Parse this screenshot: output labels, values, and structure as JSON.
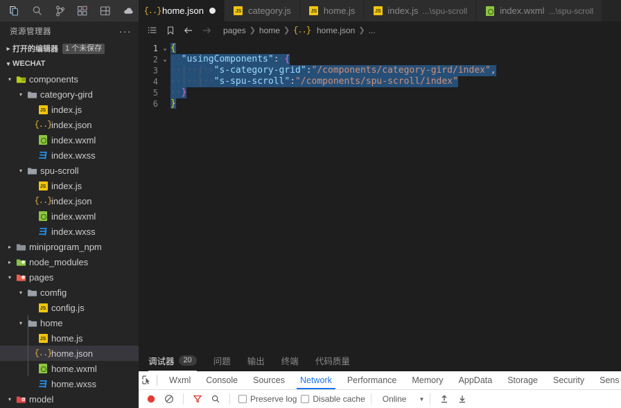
{
  "activity_bar": {
    "icons": [
      {
        "name": "explorer-icon",
        "label": "Explorer"
      },
      {
        "name": "search-icon",
        "label": "Search"
      },
      {
        "name": "source-control-icon",
        "label": "Source Control"
      },
      {
        "name": "extensions-icon",
        "label": "Extensions"
      },
      {
        "name": "layout-icon",
        "label": "Layout"
      },
      {
        "name": "debug-cloud-icon",
        "label": "Cloud"
      }
    ]
  },
  "explorer": {
    "title": "资源管理器",
    "more_label": "···",
    "open_editors": {
      "label": "打开的编辑器",
      "badge": "1 个未保存",
      "twisty": "▸"
    },
    "workspace": {
      "label": "WECHAT",
      "twisty": "▾"
    },
    "tree": [
      {
        "label": "components",
        "depth": 1,
        "type": "folder-components",
        "twisty": "▾"
      },
      {
        "label": "category-gird",
        "depth": 2,
        "type": "folder",
        "twisty": "▾"
      },
      {
        "label": "index.js",
        "depth": 3,
        "type": "js",
        "twisty": ""
      },
      {
        "label": "index.json",
        "depth": 3,
        "type": "json",
        "twisty": ""
      },
      {
        "label": "index.wxml",
        "depth": 3,
        "type": "wxml",
        "twisty": ""
      },
      {
        "label": "index.wxss",
        "depth": 3,
        "type": "wxss",
        "twisty": ""
      },
      {
        "label": "spu-scroll",
        "depth": 2,
        "type": "folder",
        "twisty": "▾"
      },
      {
        "label": "index.js",
        "depth": 3,
        "type": "js",
        "twisty": ""
      },
      {
        "label": "index.json",
        "depth": 3,
        "type": "json",
        "twisty": ""
      },
      {
        "label": "index.wxml",
        "depth": 3,
        "type": "wxml",
        "twisty": ""
      },
      {
        "label": "index.wxss",
        "depth": 3,
        "type": "wxss",
        "twisty": ""
      },
      {
        "label": "miniprogram_npm",
        "depth": 1,
        "type": "folder-dark",
        "twisty": "▸"
      },
      {
        "label": "node_modules",
        "depth": 1,
        "type": "folder-node",
        "twisty": "▸"
      },
      {
        "label": "pages",
        "depth": 1,
        "type": "folder-pages",
        "twisty": "▾"
      },
      {
        "label": "comfig",
        "depth": 2,
        "type": "folder",
        "twisty": "▾"
      },
      {
        "label": "config.js",
        "depth": 3,
        "type": "js",
        "twisty": ""
      },
      {
        "label": "home",
        "depth": 2,
        "type": "folder",
        "twisty": "▾"
      },
      {
        "label": "home.js",
        "depth": 3,
        "type": "js",
        "twisty": ""
      },
      {
        "label": "home.json",
        "depth": 3,
        "type": "json",
        "twisty": "",
        "selected": true
      },
      {
        "label": "home.wxml",
        "depth": 3,
        "type": "wxml",
        "twisty": ""
      },
      {
        "label": "home.wxss",
        "depth": 3,
        "type": "wxss",
        "twisty": ""
      },
      {
        "label": "model",
        "depth": 1,
        "type": "folder-model",
        "twisty": "▾"
      }
    ]
  },
  "tabs": [
    {
      "label": "home.json",
      "sub": "",
      "type": "json",
      "active": true,
      "dirty": true
    },
    {
      "label": "category.js",
      "sub": "",
      "type": "js",
      "active": false,
      "dirty": false
    },
    {
      "label": "home.js",
      "sub": "",
      "type": "js",
      "active": false,
      "dirty": false
    },
    {
      "label": "index.js",
      "sub": "...\\spu-scroll",
      "type": "js",
      "active": false,
      "dirty": false
    },
    {
      "label": "index.wxml",
      "sub": "...\\spu-scroll",
      "type": "wxml",
      "active": false,
      "dirty": false
    }
  ],
  "breadcrumbs": {
    "buttons": [
      "list-icon",
      "bookmark-icon",
      "arrow-left-icon",
      "arrow-right-icon"
    ],
    "path": [
      "pages",
      "home",
      "home.json",
      "..."
    ]
  },
  "editor": {
    "lines": [
      {
        "num": "1",
        "fold": "⌄",
        "indent": 0
      },
      {
        "num": "2",
        "fold": "⌄",
        "indent": 1
      },
      {
        "num": "3",
        "fold": "",
        "indent": 2
      },
      {
        "num": "4",
        "fold": "",
        "indent": 2
      },
      {
        "num": "5",
        "fold": "",
        "indent": 1
      },
      {
        "num": "6",
        "fold": "",
        "indent": 0
      }
    ],
    "line1_open": "{",
    "line2_key": "\"usingComponents\"",
    "line2_colon": ":",
    "line2_brace": "{",
    "line3_key": "\"s-category-grid\"",
    "line3_colon": ":",
    "line3_val": "\"/components/category-gird/index\"",
    "line3_comma": ",",
    "line4_key": "\"s-spu-scroll\"",
    "line4_colon": ":",
    "line4_val": "\"/components/spu-scroll/index\"",
    "line5_close": "}",
    "line6_close": "}"
  },
  "panel": {
    "tabs": [
      {
        "label": "调试器",
        "badge": "20",
        "active": true
      },
      {
        "label": "问题",
        "badge": "",
        "active": false
      },
      {
        "label": "输出",
        "badge": "",
        "active": false
      },
      {
        "label": "终端",
        "badge": "",
        "active": false
      },
      {
        "label": "代码质量",
        "badge": "",
        "active": false
      }
    ]
  },
  "devtools": {
    "inspect_icon": "inspect-element-icon",
    "tabs": [
      {
        "label": "Wxml",
        "active": false
      },
      {
        "label": "Console",
        "active": false
      },
      {
        "label": "Sources",
        "active": false
      },
      {
        "label": "Network",
        "active": true
      },
      {
        "label": "Performance",
        "active": false
      },
      {
        "label": "Memory",
        "active": false
      },
      {
        "label": "AppData",
        "active": false
      },
      {
        "label": "Storage",
        "active": false
      },
      {
        "label": "Security",
        "active": false
      },
      {
        "label": "Sens",
        "active": false
      }
    ],
    "toolbar": {
      "record_label": "record-button",
      "clear_label": "clear-button",
      "filter_label": "filter-button",
      "search_label": "search-button",
      "preserve_log": "Preserve log",
      "disable_cache": "Disable cache",
      "throttling": "Online",
      "caret": "▼",
      "import_label": "import-har-button",
      "export_label": "export-har-button"
    }
  },
  "colors": {
    "accent_blue": "#1a73e8",
    "selection_blue": "#264f78",
    "string_orange": "#ce9178",
    "key_blue": "#9cdcfe",
    "brace_yellow": "#ffd700",
    "brace_purple": "#da70d6",
    "record_red": "#e53935",
    "panel_bg": "#1e1e1e",
    "sidebar_bg": "#252526"
  }
}
